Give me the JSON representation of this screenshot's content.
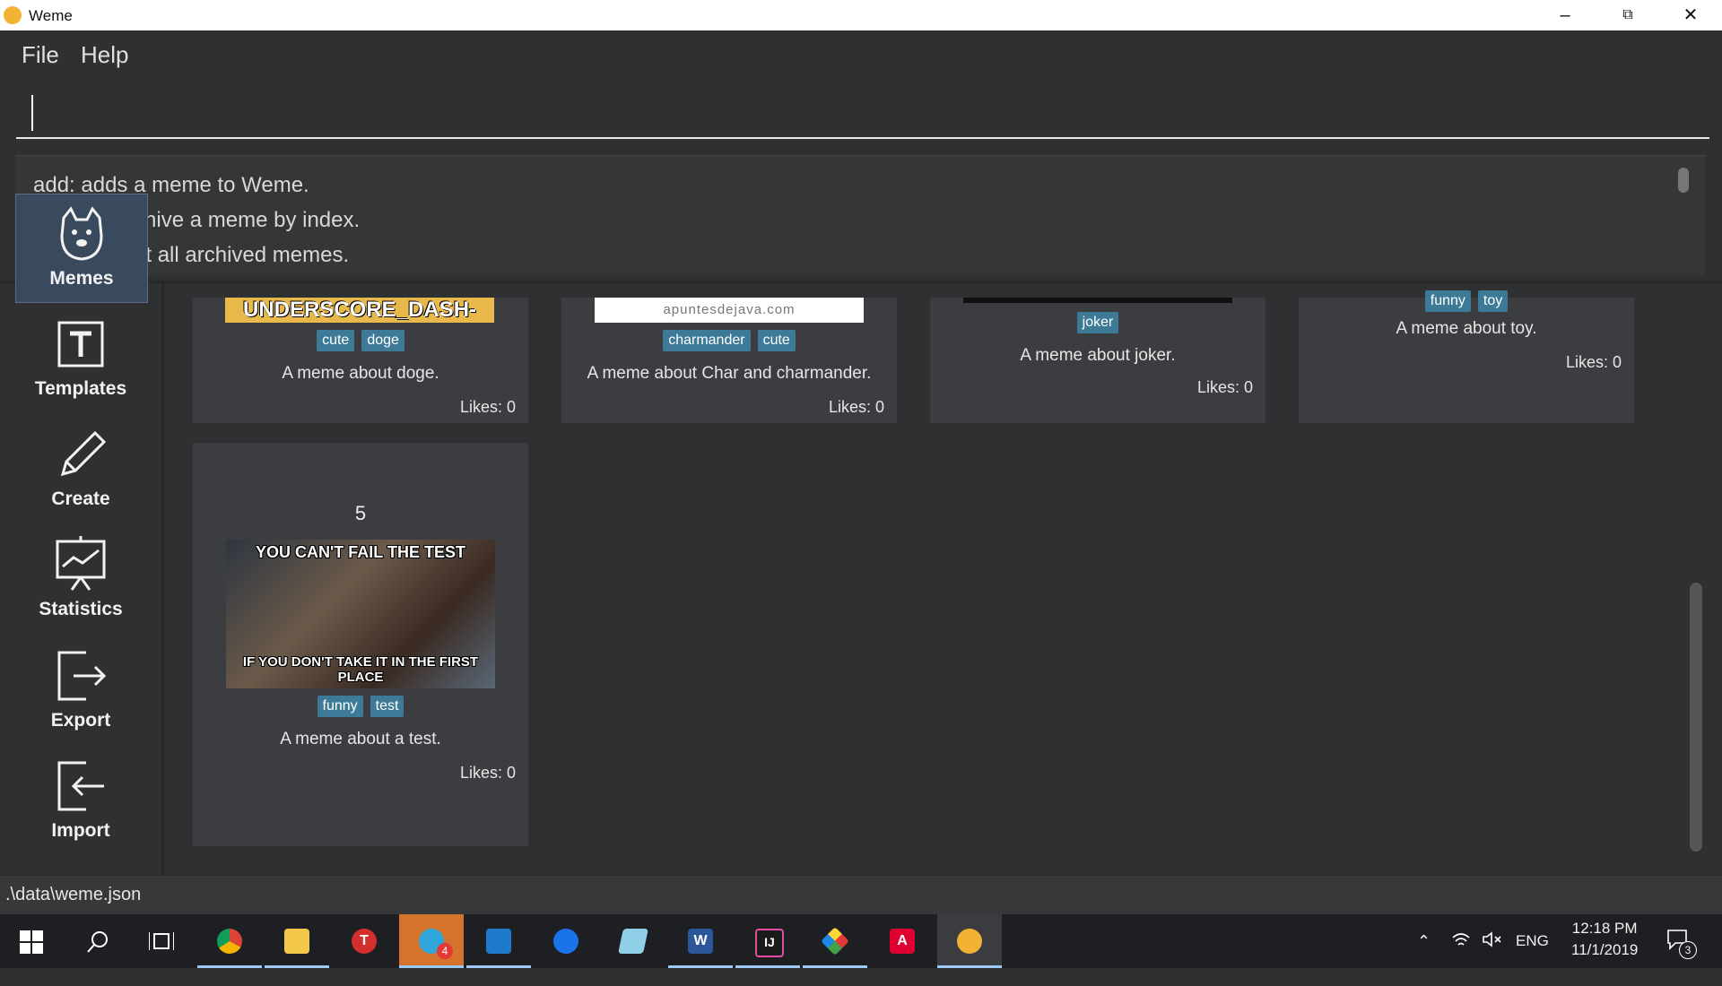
{
  "window": {
    "title": "Weme",
    "minimize_icon": "minimize-icon",
    "restore_icon": "restore-icon",
    "close_icon": "close-icon"
  },
  "menu": {
    "file": "File",
    "help": "Help"
  },
  "command": {
    "value": ""
  },
  "result": {
    "lines": [
      "add: adds a meme to Weme.",
      "archive: archive a meme by index.",
      "archives: list all archived memes."
    ]
  },
  "sidebar": {
    "items": [
      {
        "label": "Memes",
        "icon": "doge-icon"
      },
      {
        "label": "Templates",
        "icon": "template-icon"
      },
      {
        "label": "Create",
        "icon": "pencil-icon"
      },
      {
        "label": "Statistics",
        "icon": "chart-icon"
      },
      {
        "label": "Export",
        "icon": "export-icon"
      },
      {
        "label": "Import",
        "icon": "import-icon"
      }
    ]
  },
  "cards": [
    {
      "image_text": "UNDERSCORE_DASH-",
      "tags": [
        "cute",
        "doge"
      ],
      "desc": "A meme about doge.",
      "likes": "Likes: 0"
    },
    {
      "image_text": "apuntesdejava.com",
      "tags": [
        "charmander",
        "cute"
      ],
      "desc": "A meme about Char and charmander.",
      "likes": "Likes: 0"
    },
    {
      "tags": [
        "joker"
      ],
      "desc": "A meme about joker.",
      "likes": "Likes: 0"
    },
    {
      "tags": [
        "funny",
        "toy"
      ],
      "desc": "A meme about toy.",
      "likes": "Likes: 0"
    },
    {
      "index": "5",
      "image_top": "YOU CAN'T FAIL THE TEST",
      "image_bottom": "IF YOU DON'T TAKE IT IN THE FIRST PLACE",
      "tags": [
        "funny",
        "test"
      ],
      "desc": "A meme about a test.",
      "likes": "Likes: 0"
    }
  ],
  "status": {
    "path": ".\\data\\weme.json"
  },
  "taskbar": {
    "badge_telegram": "4",
    "language": "ENG",
    "time": "12:18 PM",
    "date": "11/1/2019",
    "notifications": "3"
  },
  "colors": {
    "accent": "#3d7a98",
    "background": "#2f3032",
    "card": "#3c3d40"
  }
}
